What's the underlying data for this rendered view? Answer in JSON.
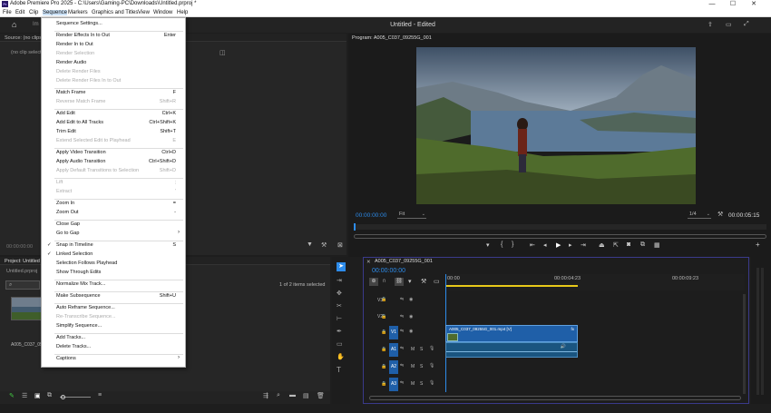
{
  "window": {
    "title": "Adobe Premiere Pro 2025 - C:\\Users\\Gaming-PC\\Downloads\\Untitled.prproj *",
    "minimize": "—",
    "maximize": "☐",
    "close": "✕"
  },
  "menubar": [
    "File",
    "Edit",
    "Clip",
    "Sequence",
    "Markers",
    "Graphics and Titles",
    "View",
    "Window",
    "Help"
  ],
  "header": {
    "project_status": "Untitled - Edited",
    "tab_partial": "Im"
  },
  "source_panel": {
    "title": "Source: (no clips)",
    "empty_text": "(no clip selected)",
    "timecode": "00:00:00:00"
  },
  "project_panel": {
    "title": "Project: Untitled",
    "file": "Untitled.prproj",
    "selection": "1 of 2 items selected",
    "item_name": "A005_C037_09255G_001"
  },
  "program_panel": {
    "title": "Program: A005_C037_09255G_001",
    "timecode": "00:00:00:00",
    "fit": "Fit",
    "resolution": "1/4",
    "duration": "00:00:05:15"
  },
  "timeline": {
    "title": "A005_C037_09255G_001",
    "timecode": "00:00:00:00",
    "ruler": [
      "00:00",
      "00:00:04:23",
      "00:00:09:23"
    ],
    "tracks_video": [
      "V3",
      "V2",
      "V1"
    ],
    "tracks_audio": [
      "A1",
      "A2",
      "A3",
      "A4"
    ],
    "clip_label": "A005_C037_09255G_001.mp4 [V]",
    "fx_label": "fx",
    "mute": "M",
    "solo": "S",
    "marker_letter": "Y",
    "clip_sound_icon": "sound-icon"
  },
  "sequence_menu": [
    {
      "label": "Sequence Settings...",
      "shortcut": "",
      "disabled": false
    },
    {
      "label": "Render Effects In to Out",
      "shortcut": "Enter",
      "disabled": false
    },
    {
      "label": "Render In to Out",
      "shortcut": "",
      "disabled": false
    },
    {
      "label": "Render Selection",
      "shortcut": "",
      "disabled": true
    },
    {
      "label": "Render Audio",
      "shortcut": "",
      "disabled": false
    },
    {
      "label": "Delete Render Files",
      "shortcut": "",
      "disabled": true
    },
    {
      "label": "Delete Render Files In to Out",
      "shortcut": "",
      "disabled": true
    },
    {
      "label": "Match Frame",
      "shortcut": "F",
      "disabled": false
    },
    {
      "label": "Reverse Match Frame",
      "shortcut": "Shift+R",
      "disabled": true
    },
    {
      "label": "Add Edit",
      "shortcut": "Ctrl+K",
      "disabled": false
    },
    {
      "label": "Add Edit to All Tracks",
      "shortcut": "Ctrl+Shift+K",
      "disabled": false
    },
    {
      "label": "Trim Edit",
      "shortcut": "Shift+T",
      "disabled": false
    },
    {
      "label": "Extend Selected Edit to Playhead",
      "shortcut": "E",
      "disabled": true
    },
    {
      "label": "Apply Video Transition",
      "shortcut": "Ctrl+D",
      "disabled": false
    },
    {
      "label": "Apply Audio Transition",
      "shortcut": "Ctrl+Shift+D",
      "disabled": false
    },
    {
      "label": "Apply Default Transitions to Selection",
      "shortcut": "Shift+D",
      "disabled": true
    },
    {
      "label": "Lift",
      "shortcut": ";",
      "disabled": true
    },
    {
      "label": "Extract",
      "shortcut": "'",
      "disabled": true
    },
    {
      "label": "Zoom In",
      "shortcut": "=",
      "disabled": false
    },
    {
      "label": "Zoom Out",
      "shortcut": "-",
      "disabled": false
    },
    {
      "label": "Close Gap",
      "shortcut": "",
      "disabled": false
    },
    {
      "label": "Go to Gap",
      "shortcut": "",
      "disabled": false,
      "submenu": true
    },
    {
      "label": "Snap in Timeline",
      "shortcut": "S",
      "disabled": false,
      "checked": true
    },
    {
      "label": "Linked Selection",
      "shortcut": "",
      "disabled": false,
      "checked": true
    },
    {
      "label": "Selection Follows Playhead",
      "shortcut": "",
      "disabled": false
    },
    {
      "label": "Show Through Edits",
      "shortcut": "",
      "disabled": false
    },
    {
      "label": "Normalize Mix Track...",
      "shortcut": "",
      "disabled": false
    },
    {
      "label": "Make Subsequence",
      "shortcut": "Shift+U",
      "disabled": false
    },
    {
      "label": "Auto Reframe Sequence...",
      "shortcut": "",
      "disabled": false
    },
    {
      "label": "Re-Transcribe Sequence...",
      "shortcut": "",
      "disabled": true
    },
    {
      "label": "Simplify Sequence...",
      "shortcut": "",
      "disabled": false
    },
    {
      "label": "Add Tracks...",
      "shortcut": "",
      "disabled": false
    },
    {
      "label": "Delete Tracks...",
      "shortcut": "",
      "disabled": false
    },
    {
      "label": "Captions",
      "shortcut": "",
      "disabled": false,
      "submenu": true
    }
  ],
  "colors": {
    "accent": "#2d8ceb",
    "clip": "#1f5fa8",
    "menu_bg": "#ffffff",
    "panel": "#262626"
  }
}
